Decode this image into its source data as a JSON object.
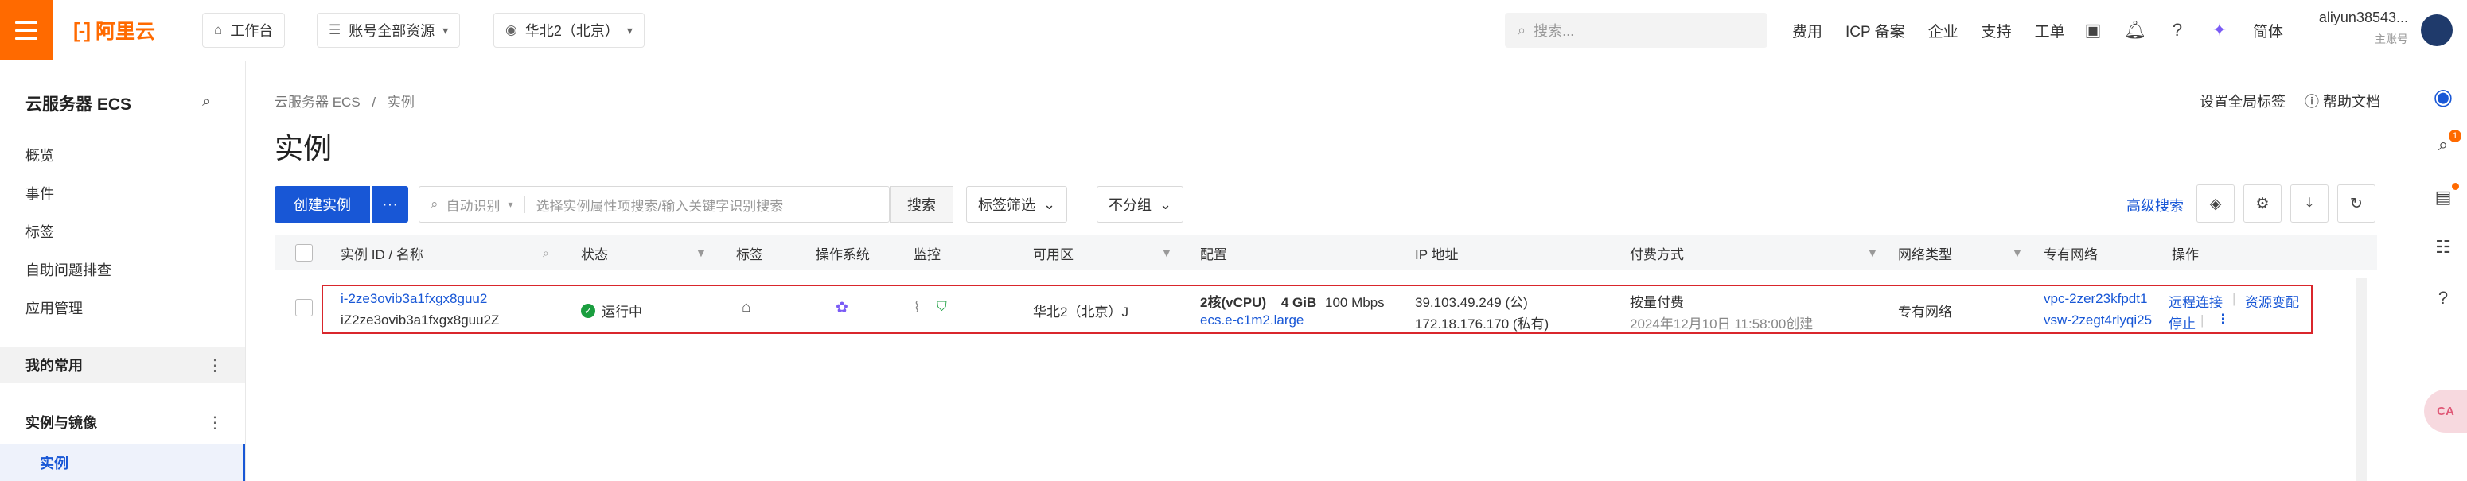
{
  "header": {
    "logo_text": "阿里云",
    "workbench": "工作台",
    "resources": "账号全部资源",
    "region": "华北2（北京）",
    "search_placeholder": "搜索...",
    "links": [
      "费用",
      "ICP 备案",
      "企业",
      "支持",
      "工单"
    ],
    "lang": "简体",
    "user_name": "aliyun38543...",
    "user_role": "主账号"
  },
  "sidebar": {
    "title": "云服务器 ECS",
    "items": [
      "概览",
      "事件",
      "标签",
      "自助问题排查",
      "应用管理"
    ],
    "group_favorites": "我的常用",
    "group_instances": "实例与镜像",
    "active_item": "实例"
  },
  "main": {
    "breadcrumb_root": "云服务器 ECS",
    "breadcrumb_sep": "/",
    "breadcrumb_current": "实例",
    "title": "实例",
    "set_global_tags": "设置全局标签",
    "help_docs": "帮助文档",
    "create_instance": "创建实例",
    "more_actions": "···",
    "search_mode": "自动识别",
    "search_placeholder": "选择实例属性项搜索/输入关键字识别搜索",
    "search_button": "搜索",
    "tag_filter": "标签筛选",
    "group_by": "不分组",
    "advanced_search": "高级搜索"
  },
  "table": {
    "columns": [
      "实例 ID / 名称",
      "状态",
      "标签",
      "操作系统",
      "监控",
      "可用区",
      "配置",
      "IP 地址",
      "付费方式",
      "网络类型",
      "专有网络",
      "操作"
    ],
    "rows": [
      {
        "id": "i-2ze3ovib3a1fxgx8guu2",
        "name": "iZ2ze3ovib3a1fxgx8guu2Z",
        "status": "运行中",
        "zone": "华北2（北京）J",
        "config_cpu": "2核(vCPU)",
        "config_mem": "4 GiB",
        "config_bw": "100 Mbps",
        "instance_type": "ecs.e-c1m2.large",
        "ip_public": "39.103.49.249 (公)",
        "ip_private": "172.18.176.170 (私有)",
        "billing": "按量付费",
        "created": "2024年12月10日 11:58:00创建",
        "network_type": "专有网络",
        "vpc": "vpc-2zer23kfpdt1",
        "vswitch": "vsw-2zegt4rlyqi25",
        "action_remote": "远程连接",
        "action_resize": "资源变配",
        "action_stop": "停止",
        "action_more": "⋮"
      }
    ]
  },
  "rail": {
    "badge_count": "1",
    "bot_text": "CA"
  },
  "colors": {
    "brand": "#ff6a00",
    "primary": "#1857d6",
    "running": "#1a9e3f",
    "highlight": "#d9262c"
  }
}
